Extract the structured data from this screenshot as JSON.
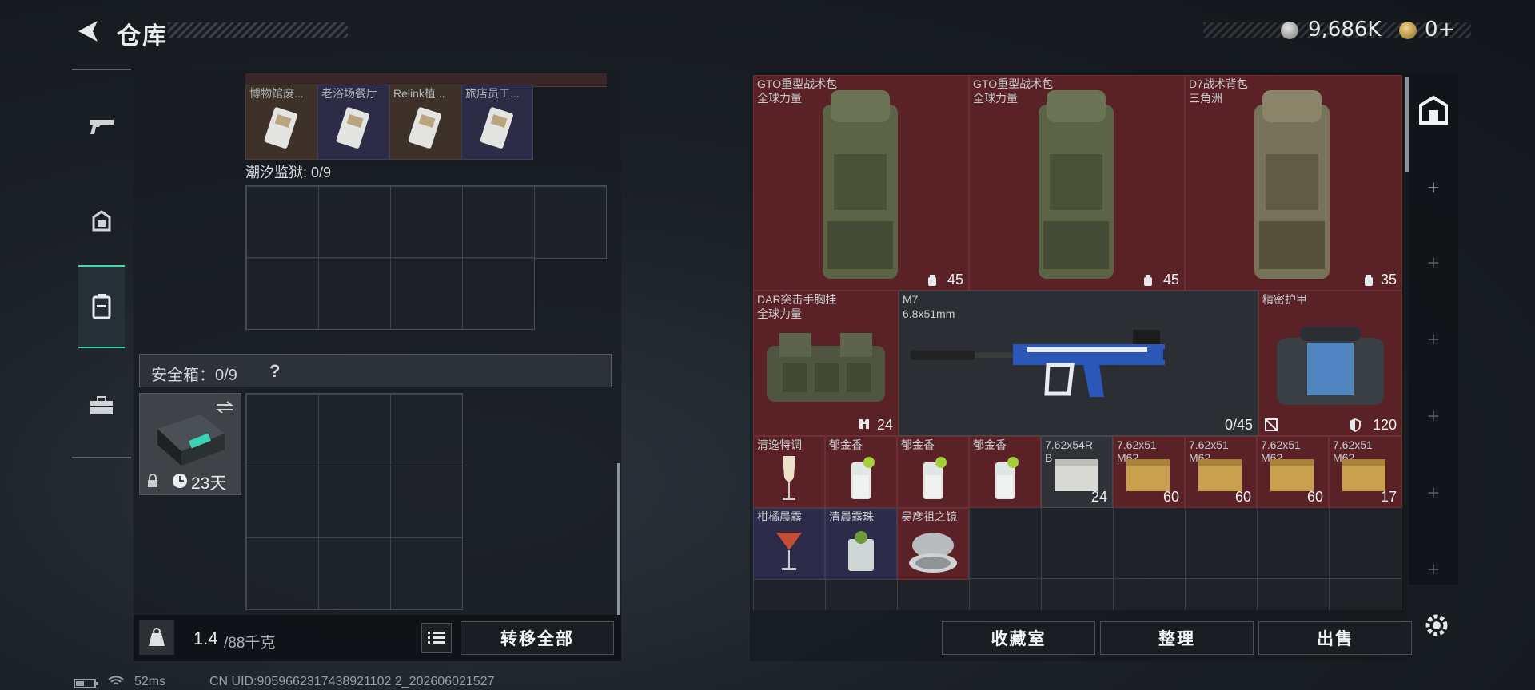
{
  "header": {
    "title": "仓库",
    "currency": {
      "amount": "9,686K",
      "premium": "0+"
    }
  },
  "sidebar": {
    "items": [
      {
        "icon": "pistol-icon"
      },
      {
        "icon": "helmet-icon"
      },
      {
        "icon": "backpack-icon",
        "active": true
      },
      {
        "icon": "toolbox-icon"
      }
    ]
  },
  "left": {
    "top_items": [
      {
        "name": "博物馆废...",
        "icon": "keycard-icon"
      },
      {
        "name": "老浴场餐厅",
        "icon": "keycard-icon"
      },
      {
        "name": "Relink植...",
        "icon": "keycard-icon"
      },
      {
        "name": "旅店员工...",
        "icon": "keycard-icon"
      }
    ],
    "section_label": "潮汐监狱: 0/9",
    "safebox_label": "安全箱：0/9",
    "safebox_help": "?",
    "safebox_days": "23天",
    "weight": "1.4",
    "weight_max": "/88千克",
    "transfer_all": "转移全部"
  },
  "right": {
    "items": [
      {
        "name": "GTO重型战术包",
        "sub": "全球力量",
        "count": "45",
        "color": "red"
      },
      {
        "name": "GTO重型战术包",
        "sub": "全球力量",
        "count": "45",
        "color": "red"
      },
      {
        "name": "D7战术背包",
        "sub": "三角洲",
        "count": "35",
        "color": "red"
      },
      {
        "name": "DAR突击手胸挂",
        "sub": "全球力量",
        "count": "24",
        "color": "red"
      },
      {
        "name": "M7",
        "sub": "6.8x51mm",
        "count": "0/45",
        "color": "dark"
      },
      {
        "name": "精密护甲",
        "sub": "",
        "count": "120",
        "color": "red"
      },
      {
        "name": "清逸特调",
        "count": "",
        "color": "red"
      },
      {
        "name": "郁金香",
        "count": "",
        "color": "red"
      },
      {
        "name": "郁金香",
        "count": "",
        "color": "red"
      },
      {
        "name": "郁金香",
        "count": "",
        "color": "red"
      },
      {
        "name": "7.62x54R",
        "sub": "B",
        "count": "24",
        "color": "dark"
      },
      {
        "name": "7.62x51",
        "sub": "M62",
        "count": "60",
        "color": "red"
      },
      {
        "name": "7.62x51",
        "sub": "M62",
        "count": "60",
        "color": "red"
      },
      {
        "name": "7.62x51",
        "sub": "M62",
        "count": "60",
        "color": "red"
      },
      {
        "name": "7.62x51",
        "sub": "M62",
        "count": "17",
        "color": "red"
      },
      {
        "name": "柑橘晨露",
        "count": "",
        "color": "purple"
      },
      {
        "name": "清晨露珠",
        "count": "",
        "color": "purple"
      },
      {
        "name": "吴彦祖之镜",
        "count": "",
        "color": "red"
      }
    ],
    "buttons": {
      "collection": "收藏室",
      "organize": "整理",
      "sell": "出售"
    }
  },
  "status": {
    "ping": "52ms",
    "uid": "CN UID:9059662317438921102 2_202606021527"
  },
  "colors": {
    "accent": "#46d6a8",
    "red_slot": "#5a2227",
    "purple_slot": "#2c2c4a"
  }
}
